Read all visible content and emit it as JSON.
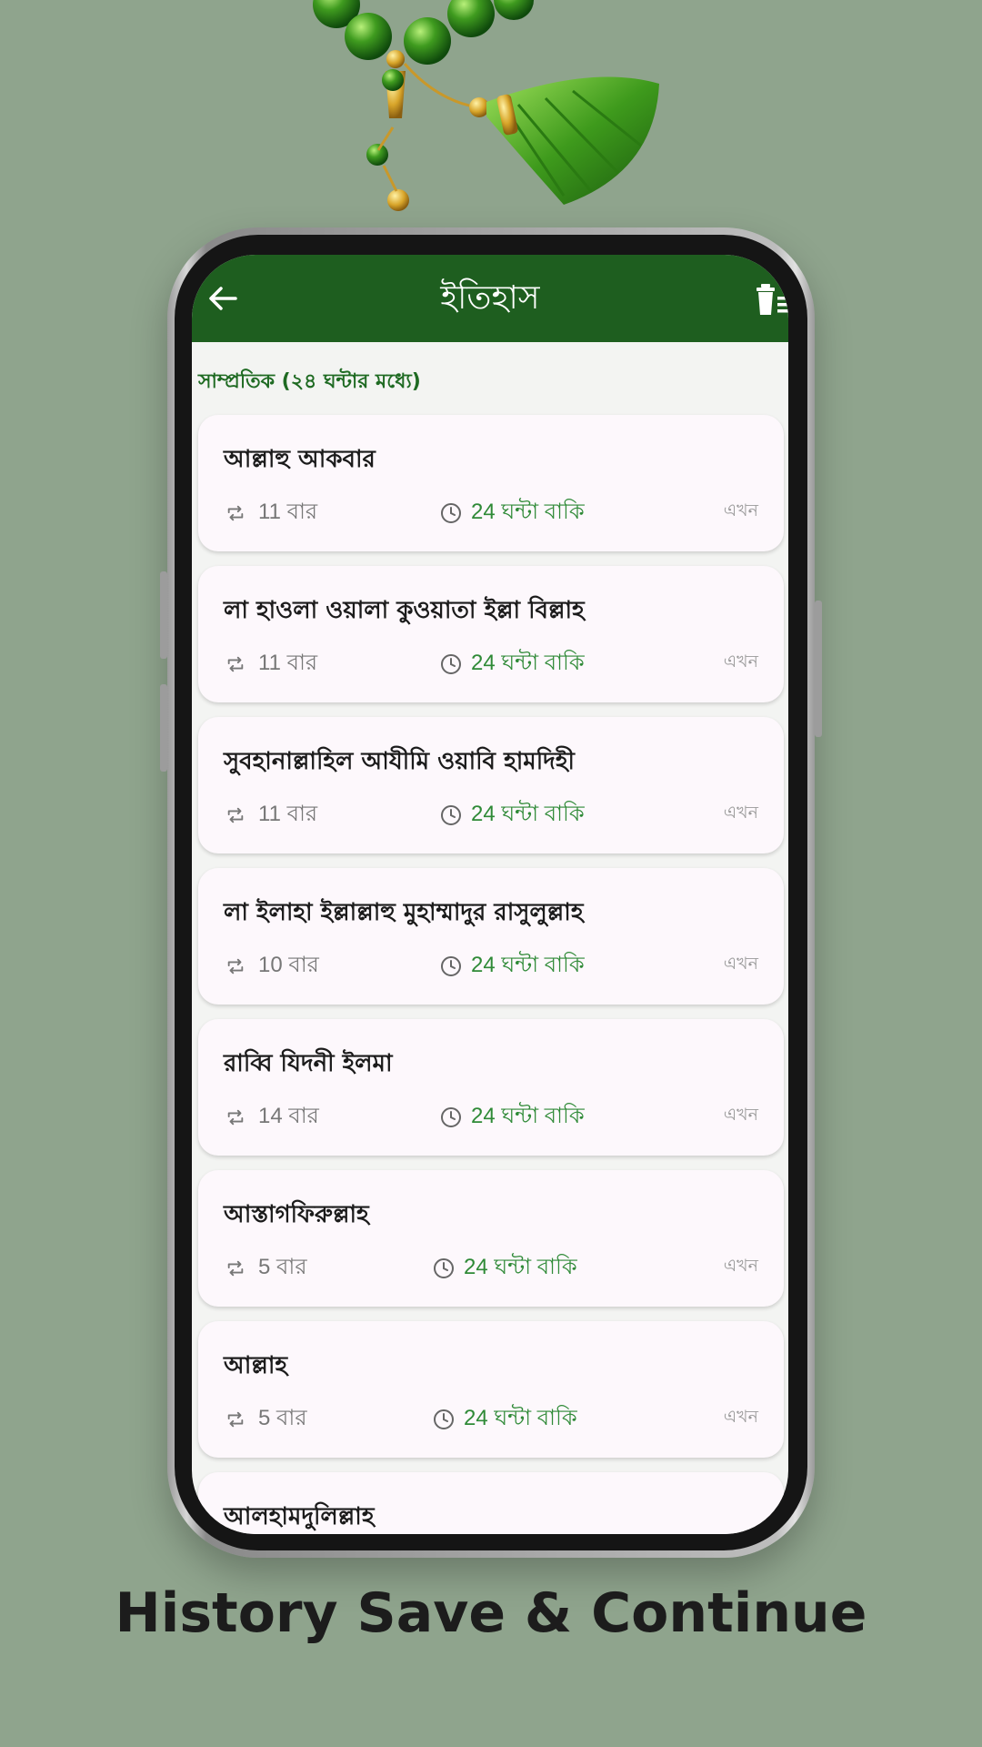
{
  "appbar": {
    "title": "ইতিহাস",
    "back_icon": "arrow-left-icon",
    "delete_icon": "trash-list-icon",
    "color": "#1e5e1f"
  },
  "section": {
    "heading": "সাম্প্রতিক (২৪ ঘন্টার মধ্যে)"
  },
  "items": [
    {
      "name": "আল্লাহু আকবার",
      "count": "11 বার",
      "remaining": "24 ঘন্টা বাকি",
      "time": "এখন"
    },
    {
      "name": "লা হাওলা ওয়ালা কুওয়াতা ইল্লা বিল্লাহ",
      "count": "11 বার",
      "remaining": "24 ঘন্টা বাকি",
      "time": "এখন"
    },
    {
      "name": "সুবহানাল্লাহিল আযীমি ওয়াবি হামদিহী",
      "count": "11 বার",
      "remaining": "24 ঘন্টা বাকি",
      "time": "এখন"
    },
    {
      "name": "লা ইলাহা ইল্লাল্লাহু মুহাম্মাদুর রাসুলুল্লাহ",
      "count": "10 বার",
      "remaining": "24 ঘন্টা বাকি",
      "time": "এখন"
    },
    {
      "name": "রাব্বি যিদনী ইলমা",
      "count": "14 বার",
      "remaining": "24 ঘন্টা বাকি",
      "time": "এখন"
    },
    {
      "name": "আস্তাগফিরুল্লাহ",
      "count": "5 বার",
      "remaining": "24 ঘন্টা বাকি",
      "time": "এখন"
    },
    {
      "name": "আল্লাহ",
      "count": "5 বার",
      "remaining": "24 ঘন্টা বাকি",
      "time": "এখন"
    },
    {
      "name": "আলহামদুলিল্লাহ"
    }
  ],
  "caption": "History Save & Continue",
  "colors": {
    "background": "#8fa48d",
    "accent_green": "#2f8a37",
    "card": "#fdf8fc"
  }
}
